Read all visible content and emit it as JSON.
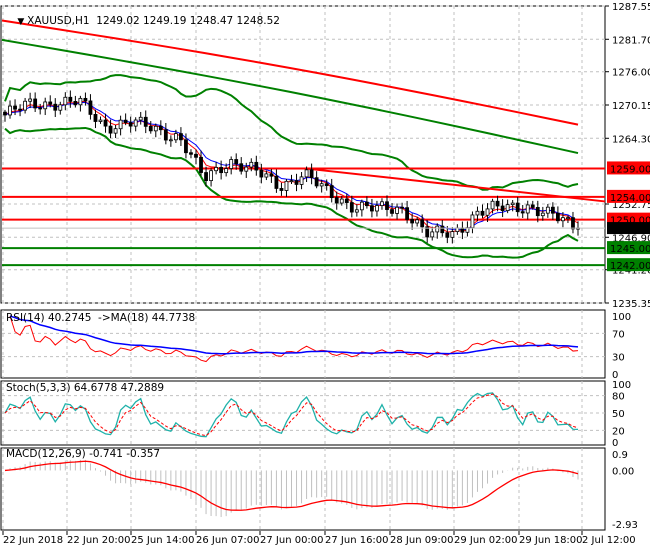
{
  "header": {
    "symbol_label": "XAUUSD,H1",
    "ohlc": "1249.02 1249.19 1248.47 1248.52",
    "menu_icon": "triangle-down-icon"
  },
  "price_axis": {
    "labels": [
      "1287.55",
      "1281.70",
      "1276.00",
      "1270.15",
      "1264.30",
      "1252.75",
      "1246.90",
      "1241.20",
      "1235.35"
    ],
    "current_price": "1248.52"
  },
  "levels": [
    {
      "label": "1259.00",
      "price": 1259.0,
      "color": "#ff0000"
    },
    {
      "label": "1254.00",
      "price": 1254.0,
      "color": "#ff0000"
    },
    {
      "label": "1250.00",
      "price": 1250.0,
      "color": "#ff0000"
    },
    {
      "label": "1245.00",
      "price": 1245.0,
      "color": "#008000"
    },
    {
      "label": "1242.00",
      "price": 1242.0,
      "color": "#008000"
    }
  ],
  "time_axis": [
    "22 Jun 2018",
    "22 Jun 20:00",
    "25 Jun 14:00",
    "26 Jun 07:00",
    "27 Jun 00:00",
    "27 Jun 16:00",
    "28 Jun 09:00",
    "29 Jun 02:00",
    "29 Jun 18:00",
    "2 Jul 12:00"
  ],
  "rsi": {
    "title": "RSI(14) 40.2745  ->MA(18) 44.7738",
    "axis": [
      "100",
      "70",
      "30",
      "0"
    ]
  },
  "stoch": {
    "title": "Stoch(5,3,3) 64.6778 47.2889",
    "axis": [
      "100",
      "80",
      "50",
      "20",
      "0"
    ]
  },
  "macd": {
    "title": "MACD(12,26,9) -0.741 -0.357",
    "axis": [
      "0.9",
      "0.00",
      "-2.93"
    ]
  },
  "colors": {
    "up": "#000000",
    "bull_fill": "#ffffff",
    "bear_fill": "#000000",
    "ma_long_red": "#ff0000",
    "ma_long_green": "#008000",
    "bands": "#008000",
    "rsi": "#ff0000",
    "rsi_ma": "#0000ff",
    "stoch_main": "#20b2aa",
    "stoch_signal": "#ff0000",
    "macd_signal": "#ff0000",
    "macd_hist": "#c0c0c0"
  },
  "chart_data": {
    "type": "candlestick",
    "price_range": [
      1235.35,
      1287.55
    ],
    "close_anchors": [
      1268.4,
      1270.2,
      1270.6,
      1270.5,
      1266.5,
      1267,
      1266,
      1264.5,
      1257,
      1260.5,
      1258.5,
      1256,
      1258,
      1254.5,
      1252.5,
      1251.7,
      1252,
      1247.3,
      1247.5,
      1251.5,
      1252,
      1252.5,
      1250.5,
      1248.5
    ],
    "ma_long_red": [
      1285,
      1266.7
    ],
    "ma_long_green": [
      1281.6,
      1261.7
    ],
    "trendline": [
      1259.0,
      1253.2
    ],
    "grid": true
  }
}
